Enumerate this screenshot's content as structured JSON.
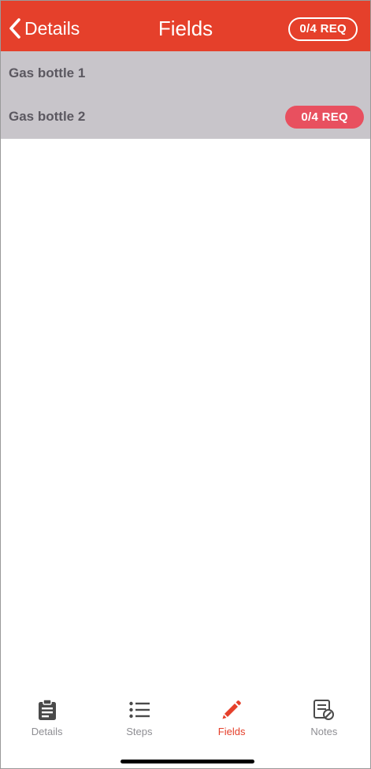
{
  "header": {
    "back_label": "Details",
    "title": "Fields",
    "req_badge": "0/4 REQ"
  },
  "fields": [
    {
      "label": "Gas bottle 1",
      "badge": ""
    },
    {
      "label": "Gas bottle 2",
      "badge": "0/4 REQ"
    }
  ],
  "tabs": [
    {
      "label": "Details",
      "icon": "clipboard-icon",
      "active": false
    },
    {
      "label": "Steps",
      "icon": "list-icon",
      "active": false
    },
    {
      "label": "Fields",
      "icon": "pencil-icon",
      "active": true
    },
    {
      "label": "Notes",
      "icon": "notes-icon",
      "active": false
    }
  ],
  "colors": {
    "header_bg": "#e5402b",
    "list_bg": "#c8c5ca",
    "badge_bg": "#e8505f",
    "active_tab": "#e5402b",
    "inactive_tab": "#8e8e93"
  }
}
